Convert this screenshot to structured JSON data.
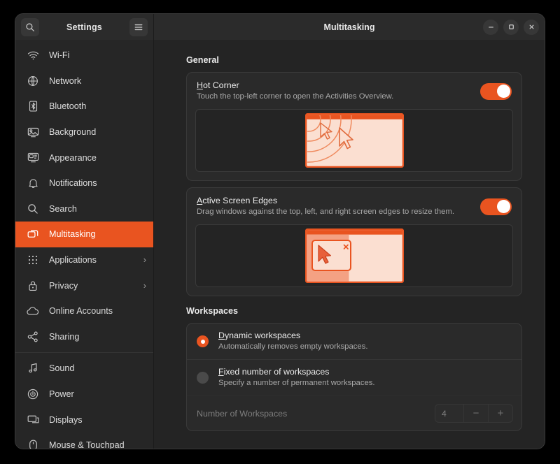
{
  "window": {
    "app_title": "Settings",
    "page_title": "Multitasking",
    "search_icon": "search-icon",
    "menu_icon": "hamburger-menu-icon",
    "minimize_label": "Minimize",
    "maximize_label": "Maximize",
    "close_label": "Close"
  },
  "sidebar": {
    "items": [
      {
        "label": "Wi-Fi",
        "icon": "wifi-icon",
        "chevron": "",
        "active": false
      },
      {
        "label": "Network",
        "icon": "network-globe-icon",
        "chevron": "",
        "active": false
      },
      {
        "label": "Bluetooth",
        "icon": "bluetooth-icon",
        "chevron": "",
        "active": false
      },
      {
        "label": "Background",
        "icon": "background-monitor-icon",
        "chevron": "",
        "active": false
      },
      {
        "label": "Appearance",
        "icon": "appearance-icon",
        "chevron": "",
        "active": false
      },
      {
        "label": "Notifications",
        "icon": "bell-icon",
        "chevron": "",
        "active": false
      },
      {
        "label": "Search",
        "icon": "search-icon",
        "chevron": "",
        "active": false
      },
      {
        "label": "Multitasking",
        "icon": "multitasking-windows-icon",
        "chevron": "",
        "active": true
      },
      {
        "label": "Applications",
        "icon": "grid-apps-icon",
        "chevron": "›",
        "active": false
      },
      {
        "label": "Privacy",
        "icon": "lock-icon",
        "chevron": "›",
        "active": false
      },
      {
        "label": "Online Accounts",
        "icon": "cloud-icon",
        "chevron": "",
        "active": false
      },
      {
        "label": "Sharing",
        "icon": "share-nodes-icon",
        "chevron": "",
        "active": false
      },
      {
        "label": "Sound",
        "icon": "music-note-icon",
        "chevron": "",
        "active": false
      },
      {
        "label": "Power",
        "icon": "power-icon",
        "chevron": "",
        "active": false
      },
      {
        "label": "Displays",
        "icon": "displays-icon",
        "chevron": "",
        "active": false
      },
      {
        "label": "Mouse & Touchpad",
        "icon": "mouse-icon",
        "chevron": "",
        "active": false
      }
    ],
    "separator_after_index": 11
  },
  "main": {
    "general": {
      "heading": "General",
      "hot_corner": {
        "title": "Hot Corner",
        "mnemonic": "H",
        "title_rest": "ot Corner",
        "subtitle": "Touch the top-left corner to open the Activities Overview.",
        "toggle_state": "on",
        "illustration": "hot-corner-illustration"
      },
      "active_screen_edges": {
        "title": "Active Screen Edges",
        "mnemonic": "A",
        "title_rest": "ctive Screen Edges",
        "subtitle": "Drag windows against the top, left, and right screen edges to resize them.",
        "toggle_state": "on",
        "illustration": "screen-edges-illustration"
      }
    },
    "workspaces": {
      "heading": "Workspaces",
      "options": [
        {
          "title": "Dynamic workspaces",
          "mnemonic": "D",
          "title_rest": "ynamic workspaces",
          "subtitle": "Automatically removes empty workspaces.",
          "selected": true
        },
        {
          "title": "Fixed number of workspaces",
          "mnemonic": "F",
          "title_rest": "ixed number of workspaces",
          "subtitle": "Specify a number of permanent workspaces.",
          "selected": false
        }
      ],
      "number_of_workspaces": {
        "label": "Number of Workspaces",
        "value": "4",
        "decrement": "−",
        "increment": "+",
        "disabled": true
      }
    }
  },
  "colors": {
    "accent": "#e95420",
    "window_bg": "#242424",
    "sidebar_bg": "#262626",
    "header_bg": "#2b2b2b",
    "card_bg": "#2a2a2a",
    "illustration_fill": "#fbdfd1"
  }
}
